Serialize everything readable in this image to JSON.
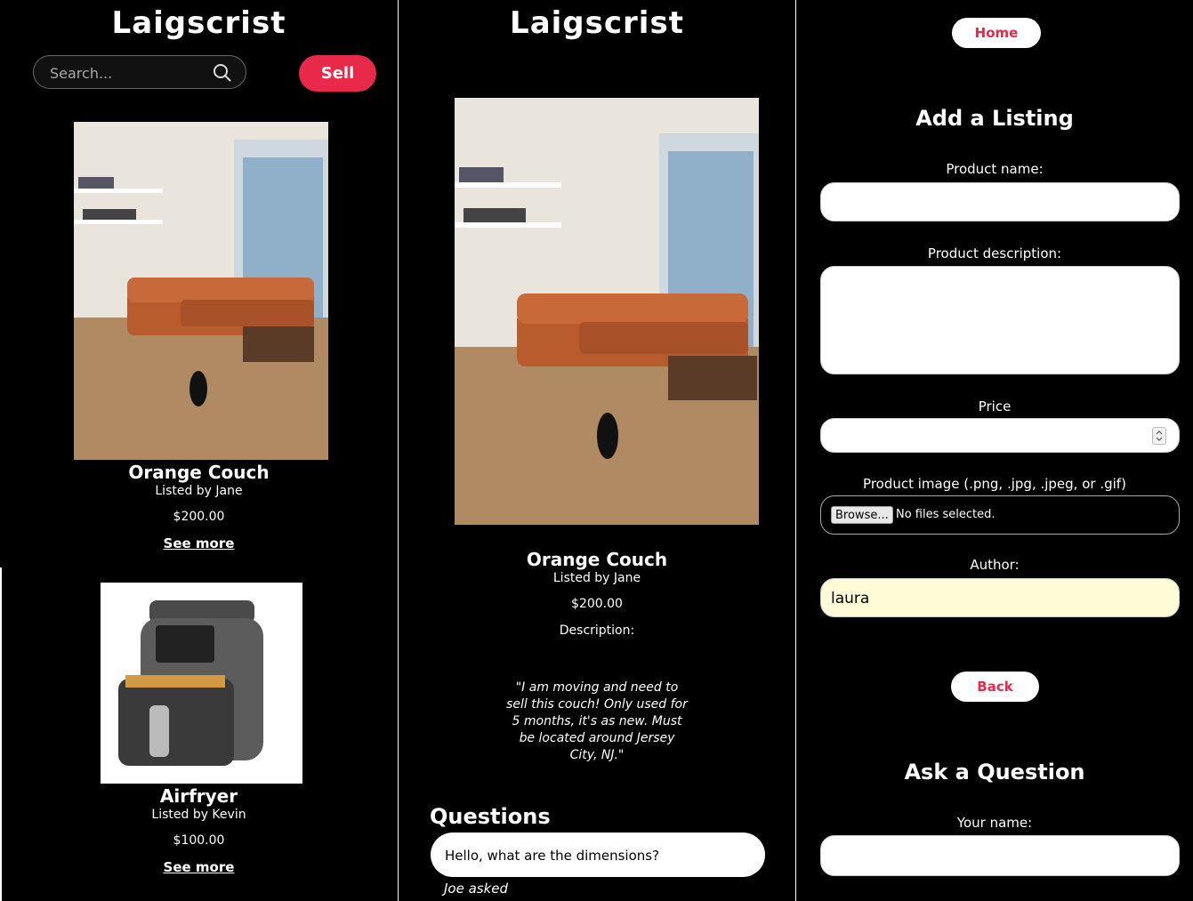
{
  "brand": "Laigscrist",
  "listing_page": {
    "search_placeholder": "Search...",
    "sell_label": "Sell",
    "items": [
      {
        "title": "Orange Couch",
        "listed_by": "Listed by Jane",
        "price": "$200.00",
        "see_more": "See more"
      },
      {
        "title": "Airfryer",
        "listed_by": "Listed by Kevin",
        "price": "$100.00",
        "see_more": "See more"
      }
    ]
  },
  "detail_page": {
    "title": "Orange Couch",
    "listed_by": "Listed by Jane",
    "price": "$200.00",
    "description_label": "Description:",
    "description": "\"I am moving and need to sell this couch! Only used for 5 months, it's as new. Must be located around Jersey City, NJ.\"",
    "questions_heading": "Questions",
    "question": {
      "text": "Hello, what are the dimensions?",
      "asker": "Joe asked"
    }
  },
  "form_page": {
    "home_label": "Home",
    "heading": "Add a Listing",
    "product_name_label": "Product name:",
    "product_description_label": "Product description:",
    "price_label": "Price",
    "image_label": "Product image (.png, .jpg, .jpeg, or .gif)",
    "browse_label": "Browse...",
    "no_files": "No files selected.",
    "author_label": "Author:",
    "author_value": "laura",
    "back_label": "Back",
    "ask_heading": "Ask a Question",
    "your_name_label": "Your name:"
  },
  "colors": {
    "accent": "#e8294a",
    "background": "#000000",
    "autofill": "#fefbd6"
  },
  "icons": [
    "search-icon",
    "couch-photo",
    "airfryer-photo",
    "spinner-icon"
  ]
}
